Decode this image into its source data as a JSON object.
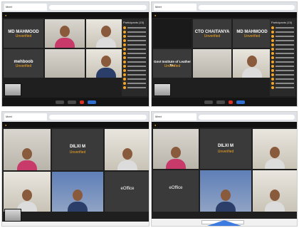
{
  "shots": [
    {
      "browser_tab": "Meet",
      "address": "",
      "app_title": "",
      "tiles": [
        {
          "name": "MD MAHMOOD",
          "status": "Unverified"
        },
        {
          "name": "",
          "status": ""
        },
        {
          "name": "",
          "status": ""
        },
        {
          "name": "mehboob",
          "status": "Unverified"
        },
        {
          "name": "",
          "status": ""
        },
        {
          "name": "",
          "status": ""
        }
      ],
      "sidebar_header": "Participants (15)"
    },
    {
      "browser_tab": "Meet",
      "address": "",
      "app_title": "",
      "tiles": [
        {
          "name": "",
          "status": ""
        },
        {
          "name": "CTO CHAITANYA",
          "status": "Unverified"
        },
        {
          "name": "MD MAHMOOD",
          "status": "Unverified"
        },
        {
          "name": "Govt Institute of Leather Te..",
          "status": "Unverified"
        },
        {
          "name": "",
          "status": ""
        },
        {
          "name": "",
          "status": ""
        }
      ],
      "sidebar_header": "Participants (15)"
    },
    {
      "browser_tab": "Meet",
      "address": "",
      "tiles": [
        {
          "name": "",
          "status": ""
        },
        {
          "name": "DILXI M",
          "status": "Unverified"
        },
        {
          "name": "",
          "status": ""
        },
        {
          "name": "",
          "status": ""
        },
        {
          "name": "",
          "status": ""
        },
        {
          "name": "eOffice",
          "status": ""
        }
      ]
    },
    {
      "browser_tab": "Meet",
      "address": "",
      "tiles": [
        {
          "name": "",
          "status": ""
        },
        {
          "name": "DILXI M",
          "status": "Unverified"
        },
        {
          "name": "",
          "status": ""
        },
        {
          "name": "",
          "status": ""
        },
        {
          "name": "",
          "status": ""
        },
        {
          "name": "eOffice",
          "status": ""
        }
      ]
    }
  ]
}
